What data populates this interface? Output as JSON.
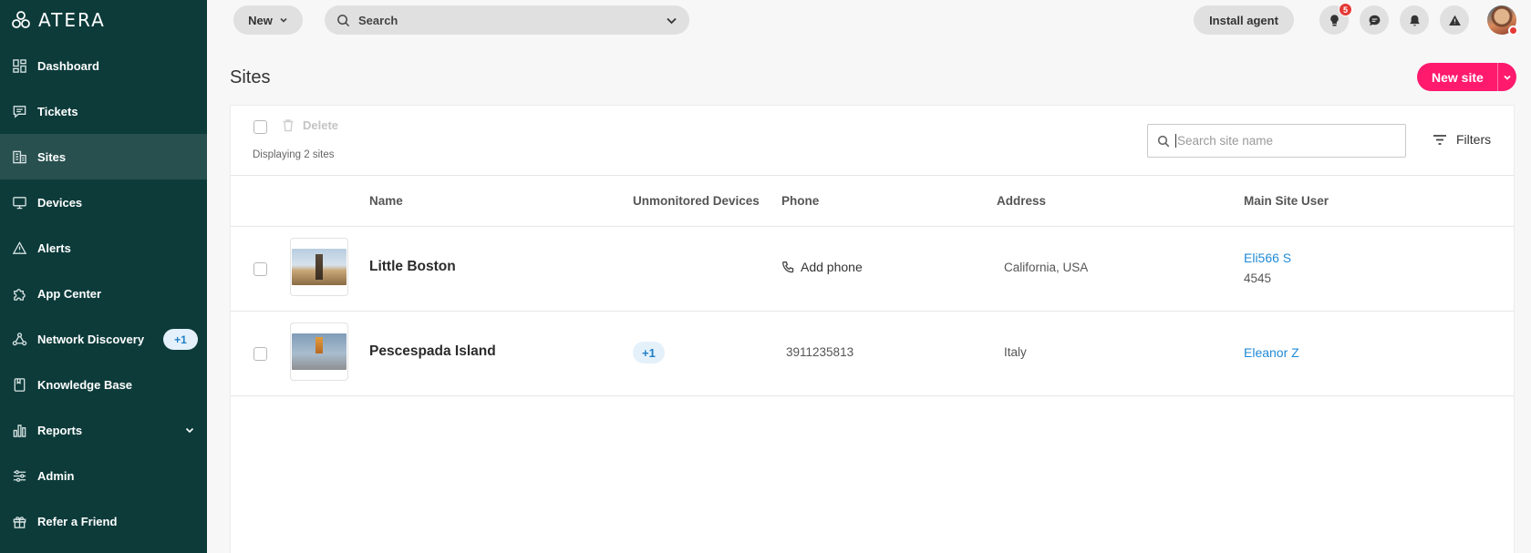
{
  "sidebar": {
    "logo_text": "ATERA",
    "items": [
      {
        "label": "Dashboard",
        "icon": "dashboard-icon"
      },
      {
        "label": "Tickets",
        "icon": "tickets-icon"
      },
      {
        "label": "Sites",
        "icon": "sites-icon",
        "active": true
      },
      {
        "label": "Devices",
        "icon": "devices-icon"
      },
      {
        "label": "Alerts",
        "icon": "alerts-icon"
      },
      {
        "label": "App Center",
        "icon": "puzzle-icon"
      },
      {
        "label": "Network Discovery",
        "icon": "network-icon",
        "badge": "+1"
      },
      {
        "label": "Knowledge Base",
        "icon": "book-icon"
      },
      {
        "label": "Reports",
        "icon": "reports-icon",
        "expandable": true
      },
      {
        "label": "Admin",
        "icon": "admin-icon"
      },
      {
        "label": "Refer a Friend",
        "icon": "gift-icon"
      }
    ]
  },
  "topbar": {
    "new_label": "New",
    "search_label": "Search",
    "install_label": "Install agent",
    "notification_count": "5"
  },
  "page": {
    "title": "Sites",
    "new_site_label": "New site"
  },
  "toolbar": {
    "delete_label": "Delete",
    "count_text": "Displaying 2 sites",
    "search_placeholder": "Search site name",
    "filters_label": "Filters"
  },
  "table": {
    "columns": [
      "Name",
      "Unmonitored Devices",
      "Phone",
      "Address",
      "Main Site User"
    ],
    "rows": [
      {
        "name": "Little Boston",
        "unmonitored": "",
        "phone": "Add phone",
        "phone_is_action": true,
        "address": "California, USA",
        "main_user": "Eli566 S",
        "main_user_sub": "4545"
      },
      {
        "name": "Pescespada Island",
        "unmonitored": "+1",
        "phone": "3911235813",
        "phone_is_action": false,
        "address": "Italy",
        "main_user": "Eleanor Z",
        "main_user_sub": ""
      }
    ]
  },
  "colors": {
    "sidebar_bg": "#0c3b3a",
    "sidebar_active": "#27504f",
    "accent_pink": "#ff1a6e",
    "link_blue": "#1f8ad6"
  }
}
